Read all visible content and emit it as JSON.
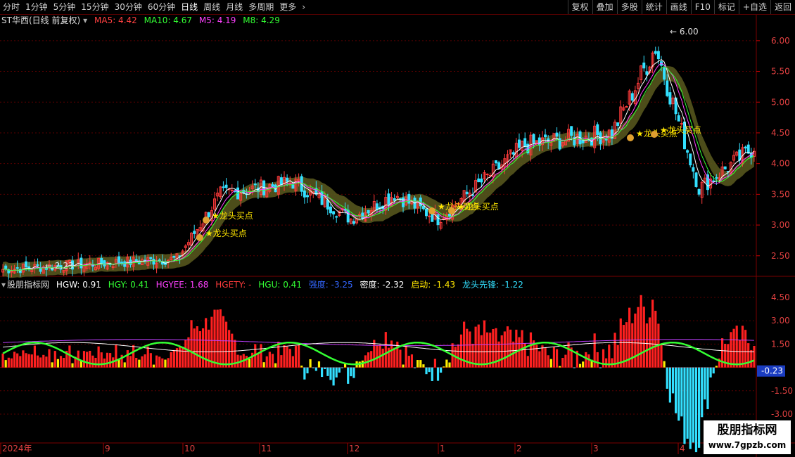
{
  "toolbar": {
    "periods": [
      "分时",
      "1分钟",
      "5分钟",
      "15分钟",
      "30分钟",
      "60分钟",
      "日线",
      "周线",
      "月线",
      "多周期",
      "更多"
    ],
    "active_period": "日线",
    "more_arrow": "›",
    "right_buttons": [
      "复权",
      "叠加",
      "多股",
      "统计",
      "画线",
      "F10",
      "标记",
      "+自选",
      "返回"
    ]
  },
  "price_panel": {
    "title": "ST华西(日线 前复权)",
    "ma5": "MA5: 4.42",
    "ma10": "MA10: 4.67",
    "m5": "M5: 4.19",
    "m8": "M8: 4.29",
    "high_label": "6.00",
    "low_label": "2.23",
    "y_ticks": [
      "6.00",
      "5.50",
      "5.00",
      "4.50",
      "4.00",
      "3.50",
      "3.00",
      "2.50"
    ],
    "annotations": [
      "★龙头买点",
      "★龙头买点",
      "★龙头买点",
      "★龙头买点",
      "★龙头买点",
      "★龙头买点"
    ],
    "colors": {
      "up": "#ff3b3b",
      "down": "#33e0ff",
      "ma5": "#ffffff",
      "ma10": "#ffe600",
      "m5": "#ff40ff",
      "m8": "#33ff33",
      "band": "#5a5a1e"
    }
  },
  "indicator_panel": {
    "title": "股朋指标网",
    "hgw": "HGW: 0.91",
    "hgy": "HGY: 0.41",
    "hgyee": "HGYEE: 1.68",
    "hgety": "HGETY: -",
    "hgu": "HGU: 0.41",
    "qiangdu": "强度: -3.25",
    "midu": "密度: -2.32",
    "qidong": "启动: -1.43",
    "longtou": "龙头先锋: -1.22",
    "y_ticks": [
      "4.50",
      "3.00",
      "1.50",
      "-1.50",
      "-3.00"
    ],
    "current_value": "-0.23"
  },
  "x_axis": {
    "labels": [
      "2024年",
      "9",
      "10",
      "11",
      "12",
      "1",
      "2",
      "3",
      "4"
    ]
  },
  "watermark": {
    "line1": "股朋指标网",
    "line2": "www.7gpzb.com"
  },
  "chart_data": {
    "type": "candlestick",
    "price_range": [
      2.2,
      6.25
    ],
    "indicator_range": [
      -3.5,
      5.0
    ],
    "segments": [
      {
        "from": 0,
        "to": 60,
        "start": 2.28,
        "end": 2.45
      },
      {
        "from": 60,
        "to": 75,
        "start": 2.45,
        "end": 3.5
      },
      {
        "from": 75,
        "to": 100,
        "start": 3.5,
        "end": 3.7
      },
      {
        "from": 100,
        "to": 120,
        "start": 3.7,
        "end": 3.1
      },
      {
        "from": 120,
        "to": 135,
        "start": 3.1,
        "end": 3.5
      },
      {
        "from": 135,
        "to": 150,
        "start": 3.5,
        "end": 3.1
      },
      {
        "from": 150,
        "to": 180,
        "start": 3.1,
        "end": 4.3
      },
      {
        "from": 180,
        "to": 210,
        "start": 4.3,
        "end": 4.5
      },
      {
        "from": 210,
        "to": 225,
        "start": 4.5,
        "end": 5.9
      },
      {
        "from": 225,
        "to": 240,
        "start": 5.9,
        "end": 3.6
      },
      {
        "from": 240,
        "to": 260,
        "start": 3.6,
        "end": 4.3
      }
    ]
  }
}
